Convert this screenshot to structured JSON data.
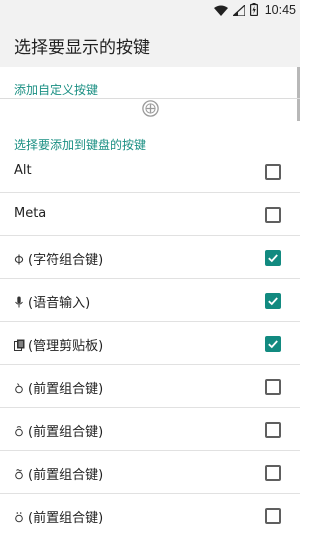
{
  "status_bar": {
    "time": "10:45",
    "icons": [
      "wifi-icon",
      "signal-icon",
      "battery-charging-icon"
    ]
  },
  "app_bar": {
    "title": "选择要显示的按键"
  },
  "sections": {
    "add_custom": "添加自定义按键",
    "select_keys": "选择要添加到键盘的按键"
  },
  "keys": [
    {
      "label": "Alt",
      "icon": "",
      "checked": false
    },
    {
      "label": "Meta",
      "icon": "",
      "checked": false
    },
    {
      "label": "(字符组合键)",
      "icon": "phi-icon",
      "checked": true
    },
    {
      "label": "(语音输入)",
      "icon": "microphone-icon",
      "checked": true
    },
    {
      "label": "(管理剪贴板)",
      "icon": "clipboard-icon",
      "checked": true
    },
    {
      "label": "(前置组合键)",
      "icon": "dead-key-icon",
      "checked": false
    },
    {
      "label": "(前置组合键)",
      "icon": "dead-key-icon",
      "checked": false
    },
    {
      "label": "(前置组合键)",
      "icon": "dead-key-icon",
      "checked": false
    },
    {
      "label": "(前置组合键)",
      "icon": "dead-key-icon",
      "checked": false
    }
  ],
  "colors": {
    "accent": "#128a80",
    "section_text": "#1a8f83",
    "app_bar_bg": "#f2f2f2"
  }
}
